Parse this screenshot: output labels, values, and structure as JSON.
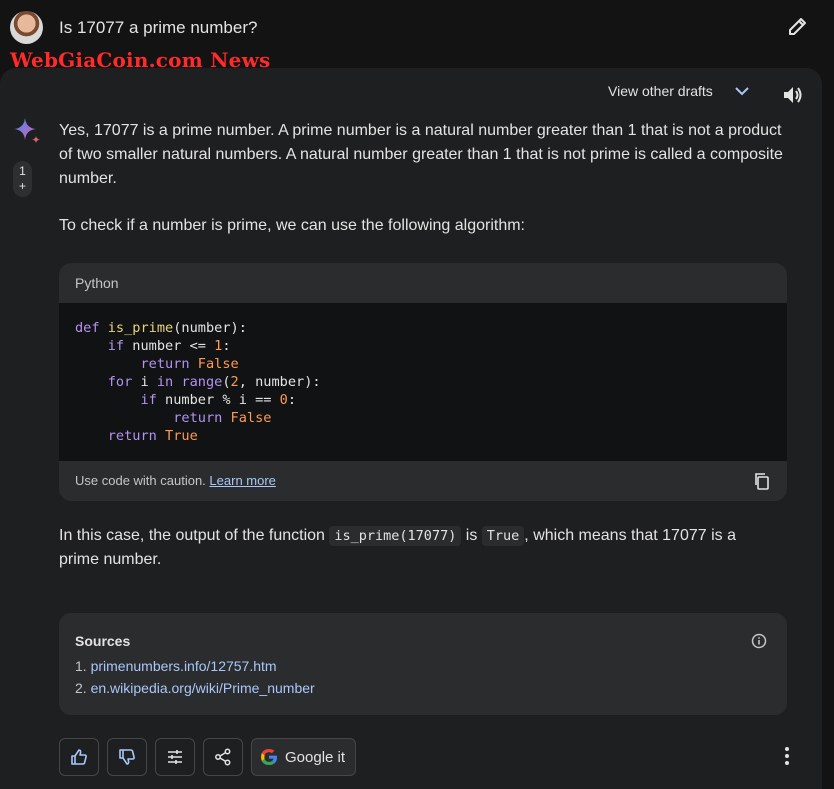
{
  "prompt": {
    "text": "Is 17077 a prime number?",
    "edit_icon": "pencil-icon"
  },
  "watermark": "WebGiaCoin.com News",
  "response_header": {
    "drafts_label": "View other drafts"
  },
  "draft_indicator": {
    "number": "1",
    "plus": "+"
  },
  "response": {
    "paragraph1": "Yes, 17077 is a prime number. A prime number is a natural number greater than 1 that is not a product of two smaller natural numbers. A natural number greater than 1 that is not prime is called a composite number.",
    "paragraph2": "To check if a number is prime, we can use the following algorithm:",
    "paragraph3_before": "In this case, the output of the function ",
    "paragraph3_code1": "is_prime(17077)",
    "paragraph3_mid": " is ",
    "paragraph3_code2": "True",
    "paragraph3_after": ", which means that 17077 is a prime number."
  },
  "code_block": {
    "language": "Python",
    "caution_text": "Use code with caution.",
    "learn_more": "Learn more",
    "lines": {
      "l1_kw": "def",
      "l1_fn": "is_prime",
      "l1_rest": "(number):",
      "l2_kw": "if",
      "l2_mid": " number <= ",
      "l2_num": "1",
      "l2_end": ":",
      "l3_kw": "return",
      "l3_lit": "False",
      "l4_kw": "for",
      "l4_mid1": " i ",
      "l4_kw2": "in",
      "l4_fn": "range",
      "l4_open": "(",
      "l4_num": "2",
      "l4_rest": ", number):",
      "l5_kw": "if",
      "l5_mid": " number % i == ",
      "l5_num": "0",
      "l5_end": ":",
      "l6_kw": "return",
      "l6_lit": "False",
      "l7_kw": "return",
      "l7_lit": "True"
    }
  },
  "sources": {
    "title": "Sources",
    "items": [
      {
        "index": "1.",
        "link": "primenumbers.info/12757.htm"
      },
      {
        "index": "2.",
        "link": "en.wikipedia.org/wiki/Prime_number"
      }
    ]
  },
  "actions": {
    "google_it": "Google it"
  },
  "colors": {
    "background": "#131314",
    "panel": "#1e1f20",
    "link": "#a8c7fa",
    "watermark": "#ff2a2a"
  }
}
